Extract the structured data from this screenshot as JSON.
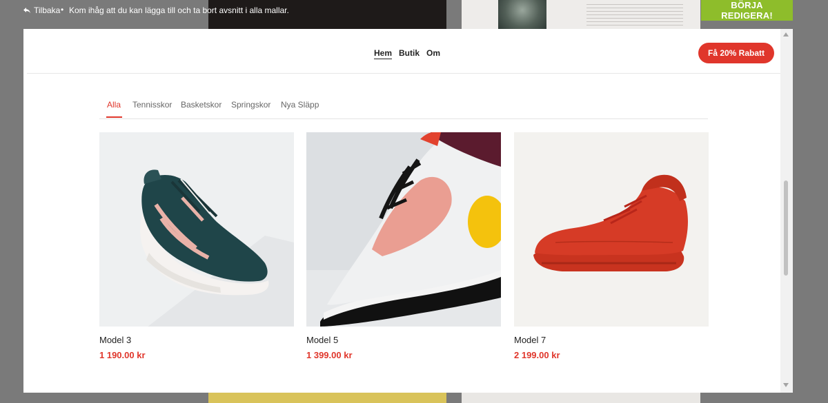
{
  "topbar": {
    "back_label": "Tilbaka",
    "bullet": "•",
    "reminder": "Kom ihåg att du kan lägga till och ta bort avsnitt i alla mallar.",
    "start_button": "BÖRJA REDIGERA!"
  },
  "site": {
    "nav": [
      "Hem",
      "Butik",
      "Om"
    ],
    "promo_button": "Få 20% Rabatt",
    "tabs": [
      "Alla",
      "Tennisskor",
      "Basketskor",
      "Springskor",
      "Nya Släpp"
    ],
    "products": [
      {
        "name": "Model 3",
        "price": "1 190.00 kr"
      },
      {
        "name": "Model 5",
        "price": "1 399.00 kr"
      },
      {
        "name": "Model 7",
        "price": "2 199.00 kr"
      }
    ]
  },
  "colors": {
    "accent": "#e0362b",
    "start_button": "#8ebd2b"
  }
}
